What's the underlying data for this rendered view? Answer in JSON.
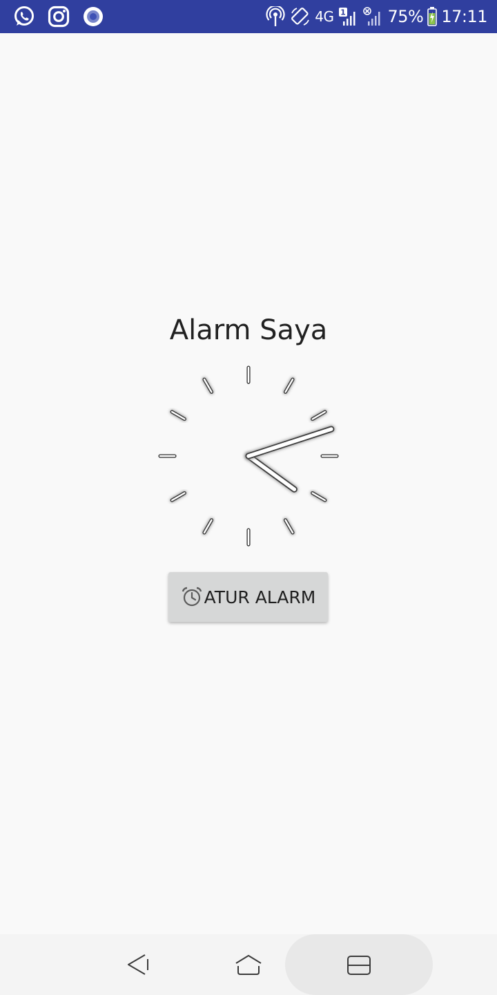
{
  "status_bar": {
    "background": "#303f9f",
    "left_icons": [
      "whatsapp-icon",
      "instagram-icon",
      "circle-record-icon"
    ],
    "network": "4G",
    "sim_badge": "1",
    "battery": "75%",
    "time": "17:11"
  },
  "main": {
    "title": "Alarm Saya",
    "clock": {
      "hour": 4,
      "minute": 12
    },
    "button": {
      "label": "ATUR ALARM",
      "icon": "alarm-clock-icon"
    }
  },
  "nav_bar": {
    "buttons": [
      "back-icon",
      "home-icon",
      "recents-icon"
    ]
  }
}
